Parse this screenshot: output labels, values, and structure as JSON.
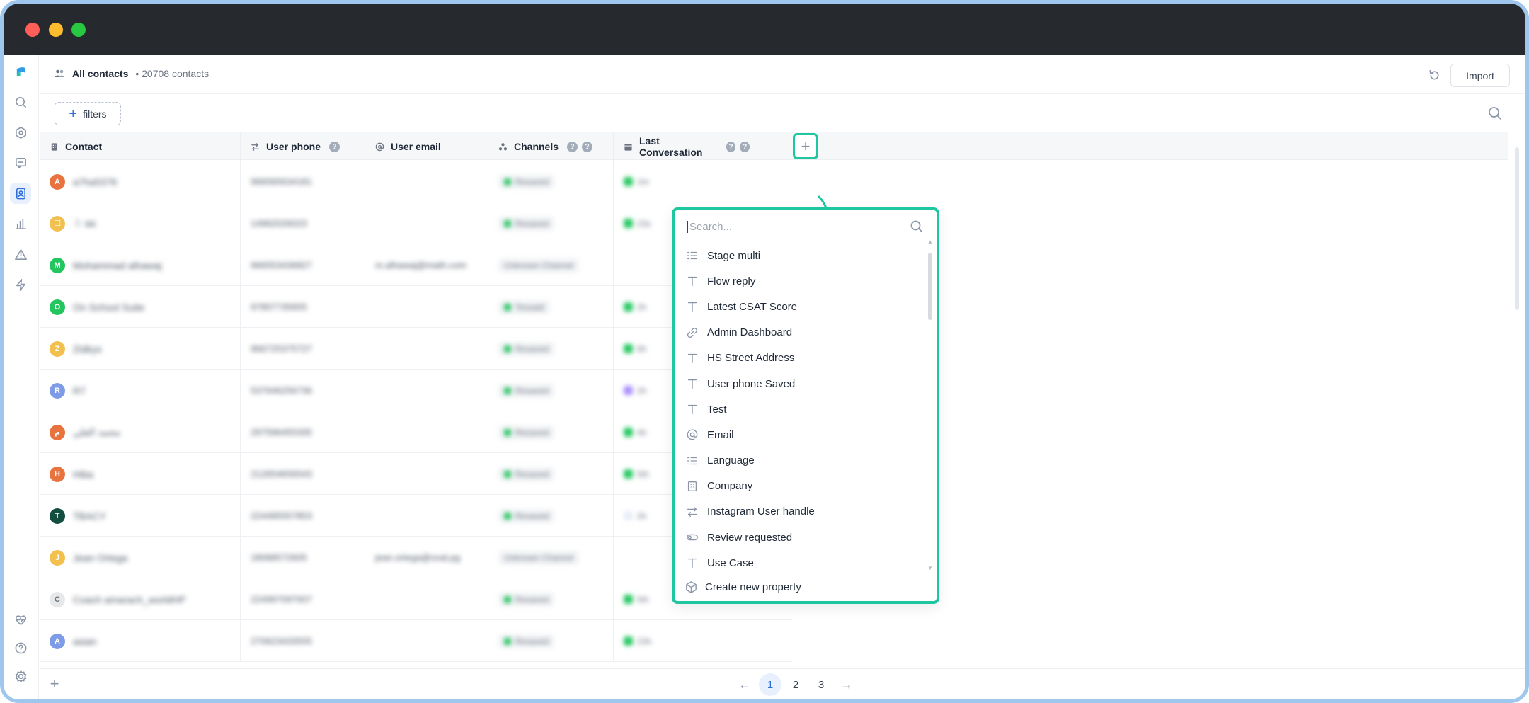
{
  "header": {
    "title": "All contacts",
    "count": "• 20708 contacts",
    "import_label": "Import"
  },
  "filter_bar": {
    "filters_label": "filters"
  },
  "nav": {
    "top_icons": [
      "logo-icon",
      "search-icon",
      "settings-hex-icon",
      "chat-icon",
      "contacts-icon",
      "chart-icon",
      "alert-icon",
      "lightning-icon"
    ],
    "bottom_icons": [
      "heartbeat-icon",
      "help-icon",
      "gear-icon"
    ]
  },
  "columns": [
    {
      "label": "Contact",
      "icon": "building-icon",
      "help": false
    },
    {
      "label": "User phone",
      "icon": "swap-icon",
      "help": true
    },
    {
      "label": "User email",
      "icon": "at-icon",
      "help": false
    },
    {
      "label": "Channels",
      "icon": "nodes-icon",
      "help": true
    },
    {
      "label": "Last Conversation",
      "icon": "calendar-icon",
      "help": true
    }
  ],
  "rows": [
    {
      "initial": "A",
      "color": "#e9733f",
      "name": "a7ha5376",
      "phone": "966565634181",
      "email": "",
      "channel": "Resaved",
      "last": "1hr"
    },
    {
      "initial": "☐",
      "color": "#f2c04e",
      "name": "☃ aa",
      "phone": "14962026023",
      "email": "",
      "channel": "Resaved",
      "last": "23s"
    },
    {
      "initial": "M",
      "color": "#22c55e",
      "name": "Mohammad alhawaj",
      "phone": "966553436827",
      "email": "m.alhawaj@math.com",
      "channel": "Unknown Channel",
      "last": ""
    },
    {
      "initial": "O",
      "color": "#22c55e",
      "name": "On School Suite",
      "phone": "97807735655",
      "email": "",
      "channel": "Tessaid",
      "last": "2h"
    },
    {
      "initial": "Z",
      "color": "#f2c04e",
      "name": "Zidkys",
      "phone": "966725375727",
      "email": "",
      "channel": "Resaved",
      "last": "6h"
    },
    {
      "initial": "R",
      "color": "#7d9be6",
      "name": "R7",
      "phone": "537646256736",
      "email": "",
      "channel": "Resaved",
      "last": "2h"
    },
    {
      "initial": "م",
      "color": "#e9733f",
      "name": "محمد العلي",
      "phone": "297596455335",
      "email": "",
      "channel": "Resaved",
      "last": "4h"
    },
    {
      "initial": "H",
      "color": "#e9733f",
      "name": "Hiba",
      "phone": "212654656543",
      "email": "",
      "channel": "Resaved",
      "last": "5th"
    },
    {
      "initial": "T",
      "color": "#134e40",
      "name": "TBACY",
      "phone": "224495557853",
      "email": "",
      "channel": "Resaved",
      "last": "2h"
    },
    {
      "initial": "J",
      "color": "#f2c04e",
      "name": "Jean Ortega",
      "phone": "18068572605",
      "email": "jean.ortega@oval.pg",
      "channel": "Unknown Channel",
      "last": ""
    },
    {
      "initial": "C",
      "color": "#e6e8ea",
      "name": "Coach amarach_worldHP",
      "phone": "224997097007",
      "email": "",
      "channel": "Resaved",
      "last": "5th"
    },
    {
      "initial": "A",
      "color": "#7d9be6",
      "name": "asian",
      "phone": "270623433555",
      "email": "",
      "channel": "Resaved",
      "last": "23h"
    }
  ],
  "dropdown": {
    "search_placeholder": "Search...",
    "items": [
      {
        "label": "Stage multi",
        "icon": "list-icon"
      },
      {
        "label": "Flow reply",
        "icon": "text-icon"
      },
      {
        "label": "Latest CSAT Score",
        "icon": "text-icon"
      },
      {
        "label": "Admin Dashboard",
        "icon": "link-icon"
      },
      {
        "label": "HS Street Address",
        "icon": "text-icon"
      },
      {
        "label": "User phone Saved",
        "icon": "text-icon"
      },
      {
        "label": "Test",
        "icon": "text-icon"
      },
      {
        "label": "Email",
        "icon": "at-icon"
      },
      {
        "label": "Language",
        "icon": "list-icon"
      },
      {
        "label": "Company",
        "icon": "building-icon"
      },
      {
        "label": "Instagram User handle",
        "icon": "swap-icon"
      },
      {
        "label": "Review requested",
        "icon": "toggle-icon"
      },
      {
        "label": "Use Case",
        "icon": "text-icon"
      }
    ],
    "create_label": "Create new property"
  },
  "pagination": {
    "prev": "←",
    "pages": [
      "1",
      "2",
      "3"
    ],
    "current": "1",
    "next": "→"
  },
  "colors": {
    "accent": "#1ec7a0",
    "primary": "#2f6fd6",
    "titlebar": "#26292d",
    "frame": "#9fc7ee"
  }
}
